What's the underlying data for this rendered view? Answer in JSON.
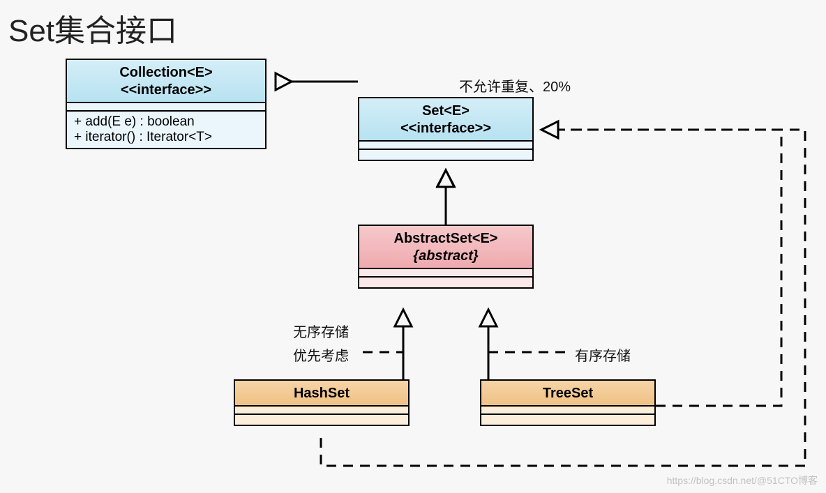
{
  "title": "Set集合接口",
  "boxes": {
    "collection": {
      "name": "Collection<E>",
      "stereotype": "<<interface>>",
      "members": [
        "+ add(E e) : boolean",
        "+ iterator() : Iterator<T>"
      ]
    },
    "set": {
      "name": "Set<E>",
      "stereotype": "<<interface>>"
    },
    "abstractset": {
      "name": "AbstractSet<E>",
      "modifier": "{abstract}"
    },
    "hashset": {
      "name": "HashSet"
    },
    "treeset": {
      "name": "TreeSet"
    }
  },
  "labels": {
    "set_note": "不允许重复、20%",
    "hashset_note1": "无序存储",
    "hashset_note2": "优先考虑",
    "treeset_note": "有序存储"
  },
  "watermark": "https://blog.csdn.net/@51CTO博客"
}
